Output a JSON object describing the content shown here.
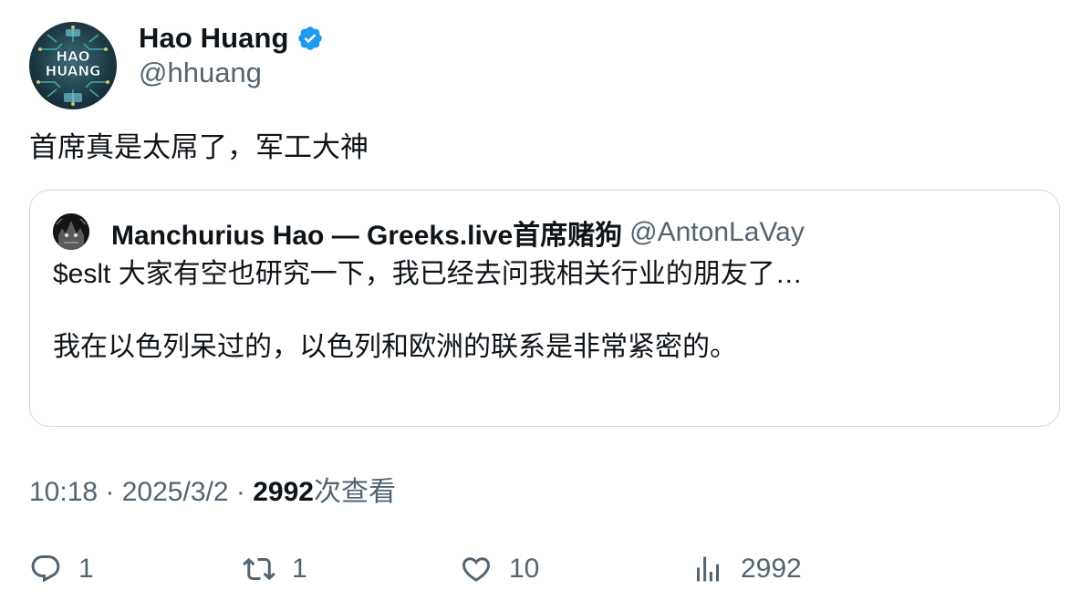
{
  "author": {
    "name": "Hao Huang",
    "handle": "@hhuang",
    "avatar_text_line1": "HAO",
    "avatar_text_line2": "HUANG"
  },
  "tweet": {
    "text": "首席真是太屌了，军工大神"
  },
  "quoted_tweet": {
    "author_name": "Manchurius Hao — Greeks.live首席赌狗",
    "author_handle": "@AntonLaVay",
    "paragraph_1": "$eslt 大家有空也研究一下，我已经去问我相关行业的朋友了…",
    "paragraph_2": "我在以色列呆过的，以色列和欧洲的联系是非常紧密的。"
  },
  "meta": {
    "time": "10:18",
    "separator": " · ",
    "date": "2025/3/2",
    "views_count": "2992",
    "views_label": "次查看"
  },
  "actions": {
    "replies": "1",
    "retweets": "1",
    "likes": "10",
    "views": "2992"
  },
  "icons": {
    "verified": "verified-badge-icon",
    "reply": "reply-icon",
    "retweet": "retweet-icon",
    "like": "heart-icon",
    "views": "analytics-icon"
  },
  "colors": {
    "verified_blue": "#1d9bf0",
    "secondary_text": "#536471",
    "primary_text": "#0f1419",
    "border": "#cfd9de"
  }
}
